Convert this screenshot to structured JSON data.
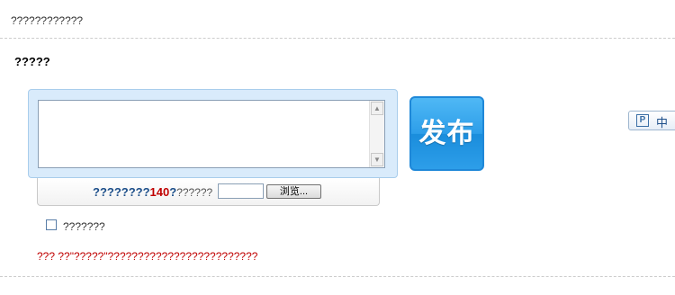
{
  "header": {
    "text": "????????????"
  },
  "section": {
    "title": "?????"
  },
  "editor": {
    "value": "",
    "scroll_up_glyph": "▲",
    "scroll_down_glyph": "▼"
  },
  "toolbar": {
    "count_prefix": "????????",
    "count_limit": "140",
    "count_mid": "?",
    "count_suffix": "??????",
    "file_value": "",
    "browse_label": "浏览..."
  },
  "publish": {
    "label": "发布",
    "color": "#2d9ee9"
  },
  "ime": {
    "icon_glyph": "P",
    "label": "中"
  },
  "checkbox": {
    "checked": false,
    "label": "???????"
  },
  "notice": {
    "text": "??? ??\"?????\"?????????????????????????",
    "color": "#c00000"
  },
  "icons": {
    "scroll_up": "arrow-up-icon",
    "scroll_down": "arrow-down-icon",
    "ime": "ime-p-icon"
  }
}
